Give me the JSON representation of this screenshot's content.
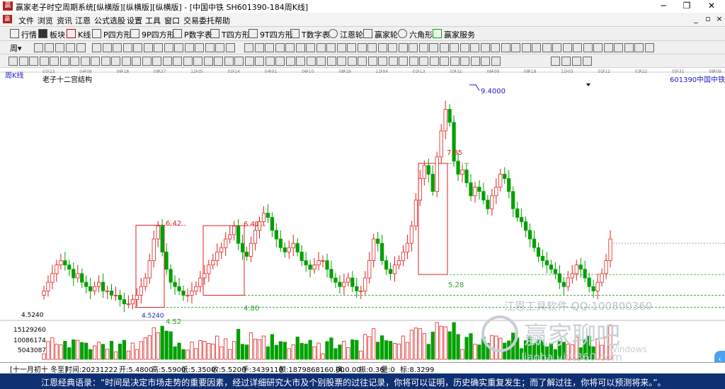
{
  "app": {
    "title": "赢家老子时空周期系统[纵横版][纵横版][纵横版] - [中国中铁  SH601390-184周K线]",
    "menu": [
      "文件",
      "浏览",
      "资讯",
      "江恩",
      "公式选股",
      "设置",
      "工具",
      "窗口",
      "交易委托",
      "帮助"
    ],
    "toolbar": [
      "行情",
      "板块",
      "K线",
      "P四方形",
      "9P四方形",
      "P数字表",
      "T四方形",
      "9T四方形",
      "T数字表",
      "江恩轮",
      "赢家轮",
      "六角形",
      "赢家服务"
    ],
    "toolbar2_value": "0"
  },
  "chart_header": {
    "period_label": "周K线",
    "structure_label": "老子十二宫结构",
    "code": "601390",
    "name": "中国中铁"
  },
  "timeline_labels": [
    "01-23",
    "04-09",
    "06-18",
    "08-27",
    "11-05",
    "01-14",
    "04-01",
    "06-10",
    "08-19",
    "11-04",
    "01-13",
    "03-31",
    "06-09",
    "08-18",
    "11-03",
    "01-12",
    "03-22",
    "05-31",
    "08-09"
  ],
  "annotations": {
    "peak": "9.4000",
    "low": "4.5240",
    "box1_top": "6.42",
    "box1_bottom": "4.52",
    "box2_top": "6.41",
    "box2_bottom": "4.80",
    "box3_top": "7.85",
    "box3_bottom": "5.28",
    "low_marker": "4.5240"
  },
  "volume_axis": [
    "15129260",
    "10086174",
    "5043087"
  ],
  "watermark": {
    "line1": "江恩工具软件  QQ:100800360",
    "line2": "赢家聊吧",
    "line3": "Windows",
    "line4": "liaoba.vict360.com"
  },
  "status": {
    "period": "[十一月初十 冬至]",
    "time": "时间:20231222",
    "open": "开:5.4800",
    "high": "高:5.5900",
    "low": "低:5.3500",
    "close": "收:5.5200",
    "hands": "手:3439110",
    "amount": "额:1879868160.00",
    "turnover": "换:0.00",
    "amplitude": "振:0.36",
    "rise": "量:0",
    "mark": "标:8.3299"
  },
  "quote": "江恩经典语录：“时间是决定市场走势的重要因素，经过详细研究大市及个别股票的过往记录，你将可以证明，历史确实重复发生；而了解过往，你将可以预测将来。”。",
  "colors": {
    "up": "#e02020",
    "down": "#00a000",
    "box": "#e02020",
    "guide": "#2aa02a"
  },
  "chart_data": {
    "type": "candlestick",
    "title": "中国中铁 SH601390 周K线",
    "ylim": [
      4.3,
      9.6
    ],
    "series_note": "weekly OHLC, approximate",
    "key_levels": [
      9.4,
      7.85,
      6.42,
      6.41,
      5.28,
      4.8,
      4.52,
      4.524
    ],
    "close_values": [
      4.9,
      5.1,
      5.3,
      5.5,
      5.6,
      5.5,
      5.4,
      5.2,
      5.3,
      5.1,
      5.0,
      4.9,
      5.0,
      5.1,
      4.9,
      4.9,
      4.8,
      4.8,
      4.7,
      4.6,
      4.6,
      4.7,
      4.8,
      5.0,
      5.2,
      5.6,
      6.1,
      6.4,
      5.8,
      5.4,
      5.1,
      5.0,
      4.9,
      4.8,
      4.8,
      4.9,
      5.0,
      5.2,
      5.3,
      5.5,
      5.6,
      5.8,
      5.9,
      6.1,
      6.2,
      6.4,
      6.0,
      5.8,
      5.7,
      6.0,
      6.3,
      6.5,
      6.7,
      6.6,
      6.3,
      6.1,
      5.9,
      5.8,
      5.9,
      6.0,
      5.8,
      5.6,
      5.5,
      5.4,
      5.5,
      5.6,
      5.6,
      5.4,
      5.2,
      5.1,
      5.0,
      5.1,
      5.2,
      5.0,
      4.9,
      4.9,
      5.2,
      5.6,
      6.1,
      6.0,
      5.6,
      5.4,
      5.3,
      5.5,
      5.6,
      5.8,
      6.0,
      6.4,
      7.0,
      7.5,
      7.8,
      7.6,
      7.2,
      8.0,
      8.6,
      9.1,
      8.8,
      7.9,
      7.6,
      7.7,
      7.4,
      7.1,
      7.3,
      7.2,
      7.0,
      6.8,
      7.1,
      7.3,
      7.6,
      7.5,
      7.2,
      6.8,
      6.6,
      6.5,
      6.3,
      6.1,
      5.9,
      5.7,
      5.6,
      5.5,
      5.4,
      5.3,
      5.1,
      5.0,
      5.2,
      5.3,
      5.5,
      5.4,
      5.2,
      5.0,
      4.9,
      5.1,
      5.3,
      5.6,
      6.1
    ],
    "volume_ylim": [
      0,
      16000000
    ]
  }
}
